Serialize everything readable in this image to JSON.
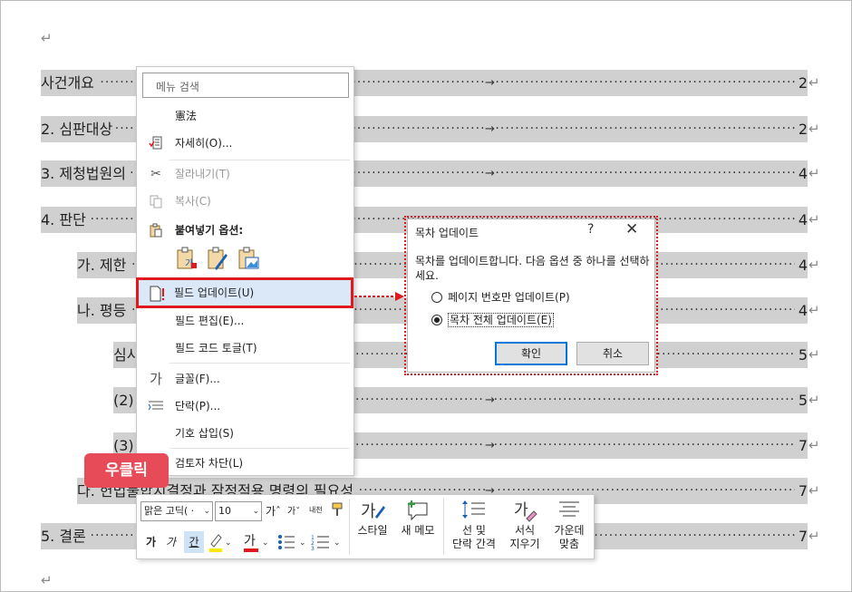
{
  "document": {
    "pilcrow": "↵",
    "toc": [
      {
        "label": "사건개요",
        "page": "2",
        "indent": 0,
        "tab": true
      },
      {
        "label": "2. 심판대상",
        "page": "2",
        "indent": 0,
        "tab": true
      },
      {
        "label": "3. 제청법원의",
        "page": "4",
        "indent": 0,
        "tab": true
      },
      {
        "label": "4. 판단",
        "page": "4",
        "indent": 0,
        "tab": false
      },
      {
        "label": "가. 제한",
        "page": "4",
        "indent": 1,
        "tab": false
      },
      {
        "label": "나. 평등",
        "page": "4",
        "indent": 1,
        "tab": false
      },
      {
        "label": "심사",
        "page": "5",
        "indent": 2,
        "tab": false
      },
      {
        "label": "(2)",
        "page": "5",
        "indent": 2,
        "tab": true
      },
      {
        "label": "(3)",
        "page": "7",
        "indent": 2,
        "tab": true
      },
      {
        "label": "다. 헌법불합치결정과 잠정적용 명령의 필요성",
        "page": "7",
        "indent": 1,
        "tab": true
      },
      {
        "label": "5. 결론",
        "page": "7",
        "indent": 0,
        "tab": false
      }
    ]
  },
  "context_menu": {
    "search_placeholder": "메뉴 검색",
    "items": [
      {
        "label": "憲法",
        "icon": "none",
        "disabled": false
      },
      {
        "label": "자세히(O)...",
        "icon": "details-icon",
        "disabled": false
      },
      {
        "label": "잘라내기(T)",
        "icon": "scissors-icon",
        "disabled": true
      },
      {
        "label": "복사(C)",
        "icon": "copy-icon",
        "disabled": true
      },
      {
        "label": "붙여넣기 옵션:",
        "icon": "paste-icon",
        "disabled": false
      },
      {
        "label": "필드 업데이트(U)",
        "icon": "update-field-icon",
        "disabled": false
      },
      {
        "label": "필드 편집(E)...",
        "icon": "none",
        "disabled": false
      },
      {
        "label": "필드 코드 토글(T)",
        "icon": "none",
        "disabled": false
      },
      {
        "label": "글꼴(F)...",
        "icon": "font-icon",
        "disabled": false
      },
      {
        "label": "단락(P)...",
        "icon": "paragraph-icon",
        "disabled": false
      },
      {
        "label": "기호 삽입(S)",
        "icon": "none",
        "disabled": false
      },
      {
        "label": "검토자 차단(L)",
        "icon": "reviewer-block-icon",
        "disabled": false
      }
    ]
  },
  "badge": {
    "label": "우클릭"
  },
  "mini_toolbar": {
    "font_name": "맑은 고딕(ㆍ",
    "font_size": "10",
    "grow_font": "가ˆ",
    "shrink_font": "가ˇ",
    "phonetic": "내천",
    "bold": "가",
    "italic": "가",
    "underline": "간",
    "styles_label": "스타일",
    "new_comment_label": "새 메모",
    "line_spacing_label_1": "선 및",
    "line_spacing_label_2": "단락 간격",
    "clear_format_label_1": "서식",
    "clear_format_label_2": "지우기",
    "center_label_1": "가운데",
    "center_label_2": "맞춤",
    "colors": {
      "highlight": "#ffe800",
      "font_color": "#e0191e"
    }
  },
  "dialog": {
    "title": "목차 업데이트",
    "help": "?",
    "close": "✕",
    "message": "목차를 업데이트합니다. 다음 옵션 중 하나를 선택하세요.",
    "options": [
      {
        "label": "페이지 번호만 업데이트(P)",
        "checked": false
      },
      {
        "label": "목차 전체 업데이트(E)",
        "checked": true
      }
    ],
    "ok_label": "확인",
    "cancel_label": "취소"
  }
}
